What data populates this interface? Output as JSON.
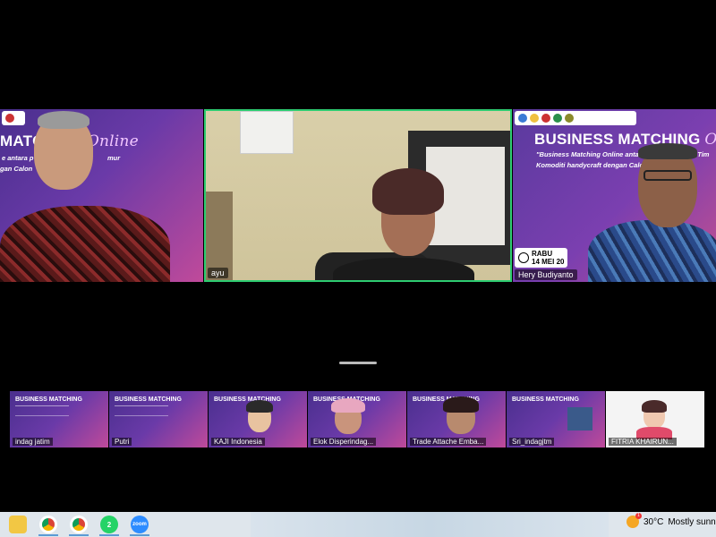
{
  "main_tiles": [
    {
      "id": "left",
      "banner_title": "MATCHING",
      "banner_script": "Online",
      "banner_sub_1": "e antara p",
      "banner_sub_2": "mur",
      "banner_sub_3": "gan Calon",
      "name": ""
    },
    {
      "id": "center",
      "name": "ayu"
    },
    {
      "id": "right",
      "banner_title": "BUSINESS MATCHING",
      "banner_script": "Onli",
      "banner_sub_1": "\"Business Matching Online antara p",
      "banner_sub_2": "awa Tim",
      "banner_sub_3": "Komoditi handycraft dengan Calon",
      "date_day": "RABU",
      "date_date": "14 MEI 20",
      "name": "Hery Budiyanto"
    }
  ],
  "thumbnails": [
    {
      "name": "indag jatim",
      "banner": "BUSINESS MATCHING"
    },
    {
      "name": "Putri",
      "banner": "BUSINESS MATCHING"
    },
    {
      "name": "KAJI Indonesia",
      "banner": "BUSINESS MATCHING"
    },
    {
      "name": "Elok Disperindag...",
      "banner": "BUSINESS MATCHING"
    },
    {
      "name": "Trade Attache Emba...",
      "banner": "BUSINESS MATCHING"
    },
    {
      "name": "Sri_indagjtm",
      "banner": "BUSINESS MATCHING"
    },
    {
      "name": "FITRIA KHAIRUN...",
      "banner": ""
    }
  ],
  "taskbar": {
    "whatsapp_badge": "2",
    "zoom_label": "zoom",
    "badge_count": "1",
    "temperature": "30°C",
    "weather": "Mostly sunn"
  },
  "colors": {
    "active_speaker_border": "#2ecc71",
    "banner_purple": "#6a3aa8"
  }
}
